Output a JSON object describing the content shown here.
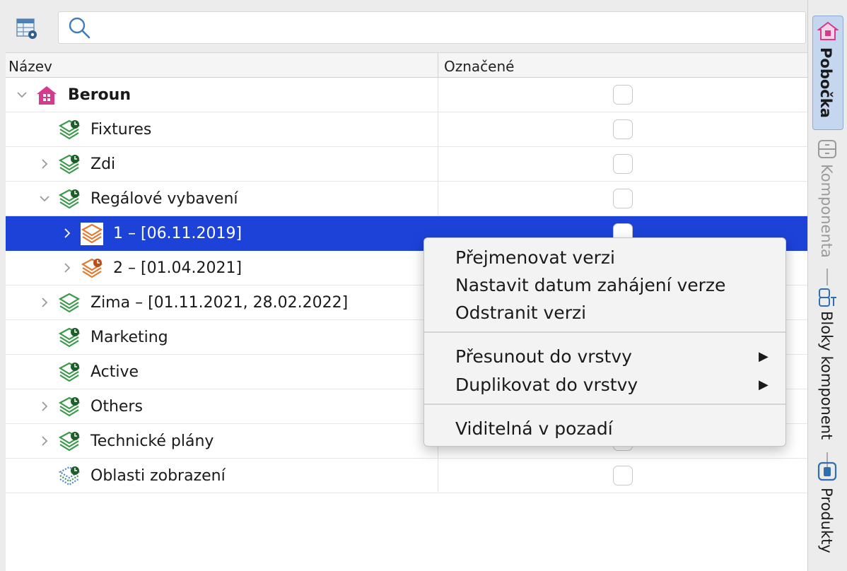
{
  "search": {
    "placeholder": "",
    "value": ""
  },
  "columns": {
    "name": "Název",
    "marked": "Označené"
  },
  "rows": [
    {
      "label": "Beroun",
      "bold": true,
      "expander": "expanded",
      "icon": "branch-house-icon",
      "checked": false
    },
    {
      "label": "Fixtures",
      "expander": "none",
      "icon": "green-layer-stack-icon",
      "checked": false
    },
    {
      "label": "Zdi",
      "expander": "collapsed",
      "icon": "green-layer-stack-icon",
      "checked": false
    },
    {
      "label": "Regálové vybavení",
      "expander": "expanded",
      "icon": "green-layer-stack-icon",
      "checked": false
    },
    {
      "label": "1 – [06.11.2019]",
      "expander": "collapsed",
      "icon": "orange-layer-stack-icon",
      "selected": true,
      "checked": false
    },
    {
      "label": "2 – [01.04.2021]",
      "expander": "collapsed",
      "icon": "orange-layer-stack-icon",
      "checked": false
    },
    {
      "label": "Zima – [01.11.2021, 28.02.2022]",
      "expander": "collapsed",
      "icon": "green-layer-stack-icon",
      "checked": false
    },
    {
      "label": "Marketing",
      "expander": "none",
      "icon": "green-layer-stack-icon",
      "checked": false
    },
    {
      "label": "Active",
      "expander": "none",
      "icon": "green-layer-stack-icon",
      "checked": false
    },
    {
      "label": "Others",
      "expander": "collapsed",
      "icon": "green-layer-stack-icon",
      "checked": false
    },
    {
      "label": "Technické plány",
      "expander": "collapsed",
      "icon": "green-layer-stack-icon",
      "checked": false
    },
    {
      "label": "Oblasti zobrazení",
      "expander": "none",
      "icon": "dotted-layer-stack-icon",
      "checked": false
    }
  ],
  "context_menu": {
    "items": [
      {
        "label": "Přejmenovat verzi"
      },
      {
        "label": "Nastavit datum zahájení verze"
      },
      {
        "label": "Odstranit verzi"
      },
      {
        "label": "Přesunout do vrstvy",
        "submenu": true
      },
      {
        "label": "Duplikovat do vrstvy",
        "submenu": true
      },
      {
        "label": "Viditelná v pozadí"
      }
    ]
  },
  "sidebar": {
    "tabs": [
      {
        "label": "Pobočka",
        "icon": "house-icon",
        "active": true
      },
      {
        "label": "Komponenta",
        "icon": "component-icon",
        "active": false
      },
      {
        "label": "Bloky komponent",
        "icon": "component-blocks-icon",
        "active": false
      },
      {
        "label": "Produkty",
        "icon": "product-icon",
        "active": false
      }
    ]
  },
  "colors": {
    "selection": "#1c42d8",
    "branch_icon": "#d63a8c",
    "layer_green": "#3a9a4a",
    "layer_orange": "#e4782e",
    "sidebar_active": "#c5d6ef"
  }
}
